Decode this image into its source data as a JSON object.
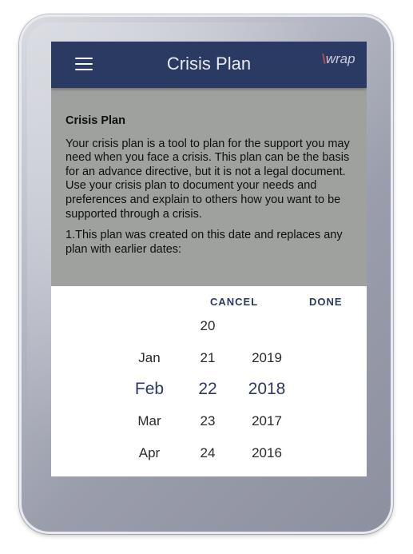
{
  "app_bar": {
    "title": "Crisis Plan",
    "logo_text": "wrap"
  },
  "content": {
    "heading": "Crisis Plan",
    "paragraphs": [
      "Your crisis plan is a tool to plan for the support you may need when you face a crisis. This plan can be the basis for an advance directive, but it is not a legal document. Use your crisis plan to document your needs and preferences and explain to others how you want to be supported through a crisis.",
      "1.This plan was created on this date and replaces any plan with earlier dates:"
    ]
  },
  "date_picker": {
    "cancel_label": "CANCEL",
    "done_label": "DONE",
    "months": [
      "",
      "Jan",
      "Feb",
      "Mar",
      "Apr"
    ],
    "days": [
      "20",
      "21",
      "22",
      "23",
      "24"
    ],
    "years": [
      "",
      "2019",
      "2018",
      "2017",
      "2016"
    ],
    "selected": {
      "month": "Feb",
      "day": "22",
      "year": "2018"
    }
  },
  "colors": {
    "app_bar": "#2b3a63",
    "content_bg": "#9fa19f",
    "accent": "#2b3a63"
  }
}
